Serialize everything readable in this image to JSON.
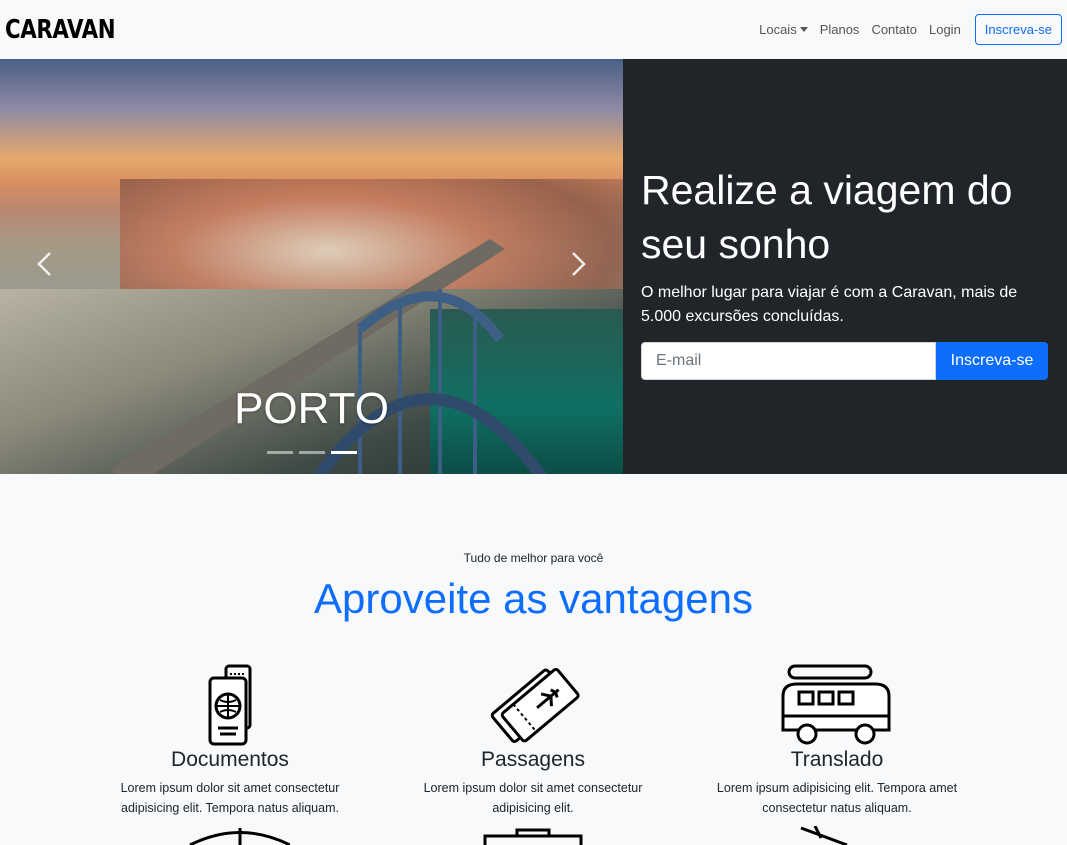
{
  "nav": {
    "brand": "CARAVAN",
    "links": {
      "locais": "Locais",
      "planos": "Planos",
      "contato": "Contato",
      "login": "Login"
    },
    "cta": "Inscreva-se"
  },
  "hero": {
    "carousel": {
      "caption": "PORTO",
      "slide_count": 3,
      "active_slide": 3
    },
    "title": "Realize a viagem do seu sonho",
    "text": "O melhor lugar para viajar é com a Caravan, mais de 5.000 excursões concluídas.",
    "email_placeholder": "E-mail",
    "subscribe_label": "Inscreva-se"
  },
  "features": {
    "eyebrow": "Tudo de melhor para você",
    "title": "Aproveite as vantagens",
    "items": [
      {
        "icon": "passport-icon",
        "title": "Documentos",
        "text": "Lorem ipsum dolor sit amet consectetur adipisicing elit. Tempora natus aliquam."
      },
      {
        "icon": "tickets-icon",
        "title": "Passagens",
        "text": "Lorem ipsum dolor sit amet consectetur adipisicing elit."
      },
      {
        "icon": "van-icon",
        "title": "Translado",
        "text": "Lorem ipsum adipisicing elit. Tempora amet consectetur natus aliquam."
      }
    ]
  },
  "colors": {
    "primary": "#0d6efd",
    "dark": "#212529",
    "light": "#f8f9fa"
  }
}
